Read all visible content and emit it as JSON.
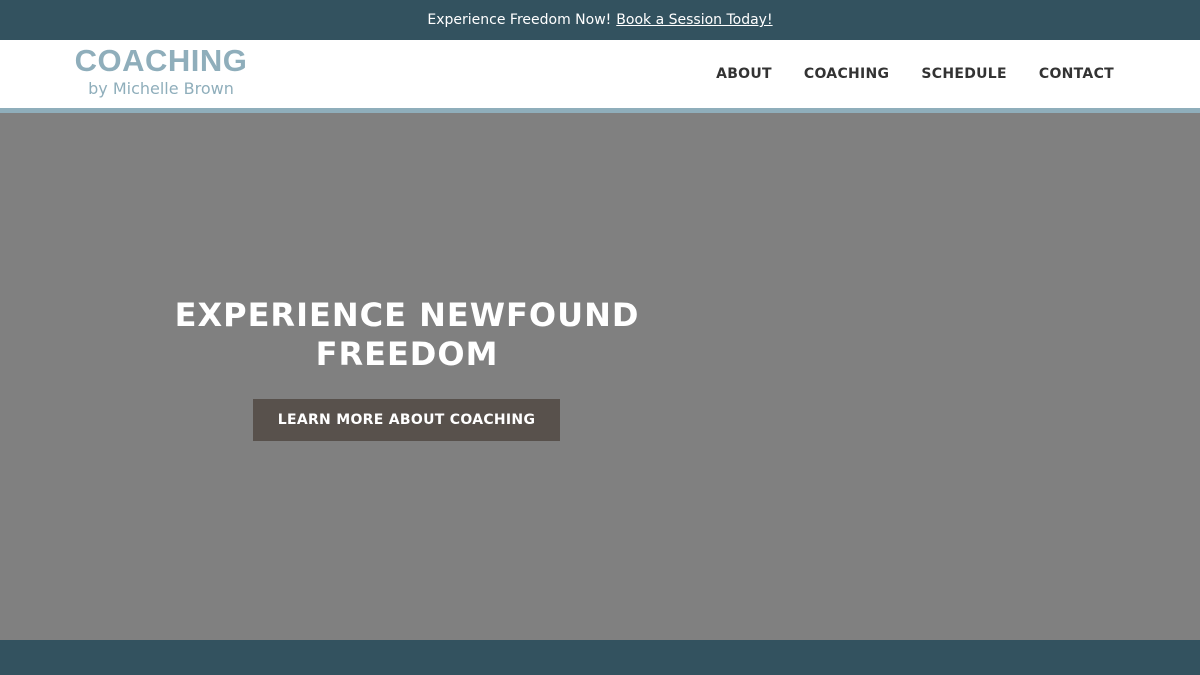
{
  "announcement": {
    "text": "Experience Freedom Now!",
    "link_label": "Book a Session Today!"
  },
  "header": {
    "logo_main": "COACHING",
    "logo_sub": "by Michelle Brown",
    "nav": [
      "ABOUT",
      "COACHING",
      "SCHEDULE",
      "CONTACT"
    ]
  },
  "hero": {
    "title": "EXPERIENCE NEWFOUND FREEDOM",
    "cta_label": "LEARN MORE ABOUT COACHING"
  },
  "colors": {
    "dark_teal": "#33525f",
    "accent_blue": "#8faebb",
    "hero_gray": "#808080",
    "button_brown": "#58514c"
  }
}
